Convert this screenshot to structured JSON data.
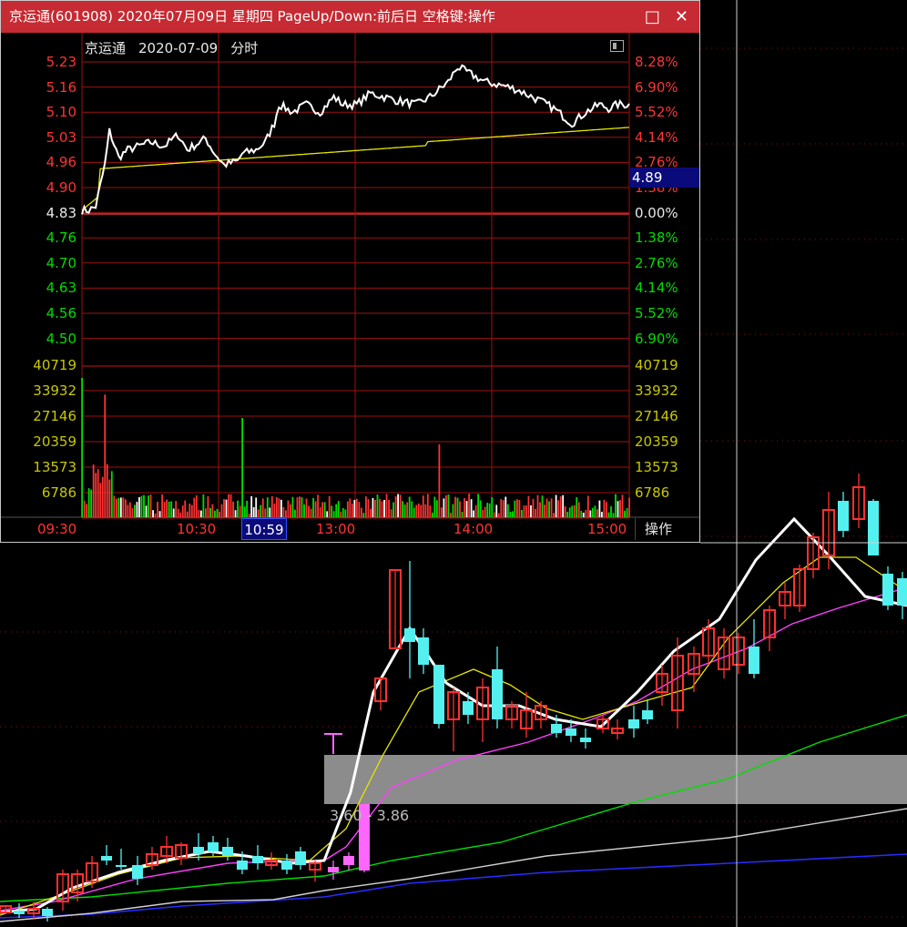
{
  "window": {
    "title": "京运通(601908) 2020年07月09日 星期四 PageUp/Down:前后日 空格键:操作",
    "maximize_glyph": "□",
    "close_glyph": "✕"
  },
  "minute_chart": {
    "stock_name": "京运通",
    "date": "2020-07-09",
    "chart_kind": "分时",
    "current_price_tag": "4.89",
    "price_ticks": [
      {
        "price": "5.23",
        "pct": "8.28%",
        "color": "red"
      },
      {
        "price": "5.16",
        "pct": "6.90%",
        "color": "red"
      },
      {
        "price": "5.10",
        "pct": "5.52%",
        "color": "red"
      },
      {
        "price": "5.03",
        "pct": "4.14%",
        "color": "red"
      },
      {
        "price": "4.96",
        "pct": "2.76%",
        "color": "red"
      },
      {
        "price": "4.90",
        "pct": "1.38%",
        "color": "red"
      },
      {
        "price": "4.83",
        "pct": "0.00%",
        "color": "white"
      },
      {
        "price": "4.76",
        "pct": "1.38%",
        "color": "green"
      },
      {
        "price": "4.70",
        "pct": "2.76%",
        "color": "green"
      },
      {
        "price": "4.63",
        "pct": "4.14%",
        "color": "green"
      },
      {
        "price": "4.56",
        "pct": "5.52%",
        "color": "green"
      },
      {
        "price": "4.50",
        "pct": "6.90%",
        "color": "green"
      }
    ],
    "volume_ticks": [
      "40719",
      "33932",
      "27146",
      "20359",
      "13573",
      "6786"
    ],
    "time_labels": [
      "09:30",
      "10:30",
      "13:00",
      "14:00",
      "15:00"
    ],
    "cursor_time": "10:59",
    "operate_label": "操作",
    "colors": {
      "up": "#ff3333",
      "down": "#00dd00",
      "price_line": "#ffffff",
      "avg_line": "#e6e600",
      "grid": "#a01010"
    }
  },
  "kline": {
    "zone_label": "3.60 - 3.86",
    "colors": {
      "up": "#ff3030",
      "down": "#54f0f0",
      "limit_up": "#ff66ff",
      "ma5": "#ffffff",
      "ma10": "#e6e600",
      "ma20": "#ff40ff",
      "ma60": "#00e000",
      "ma120": "#d0d0d0",
      "ma250": "#2a2aff",
      "zone": "#8c8c8c"
    }
  }
}
